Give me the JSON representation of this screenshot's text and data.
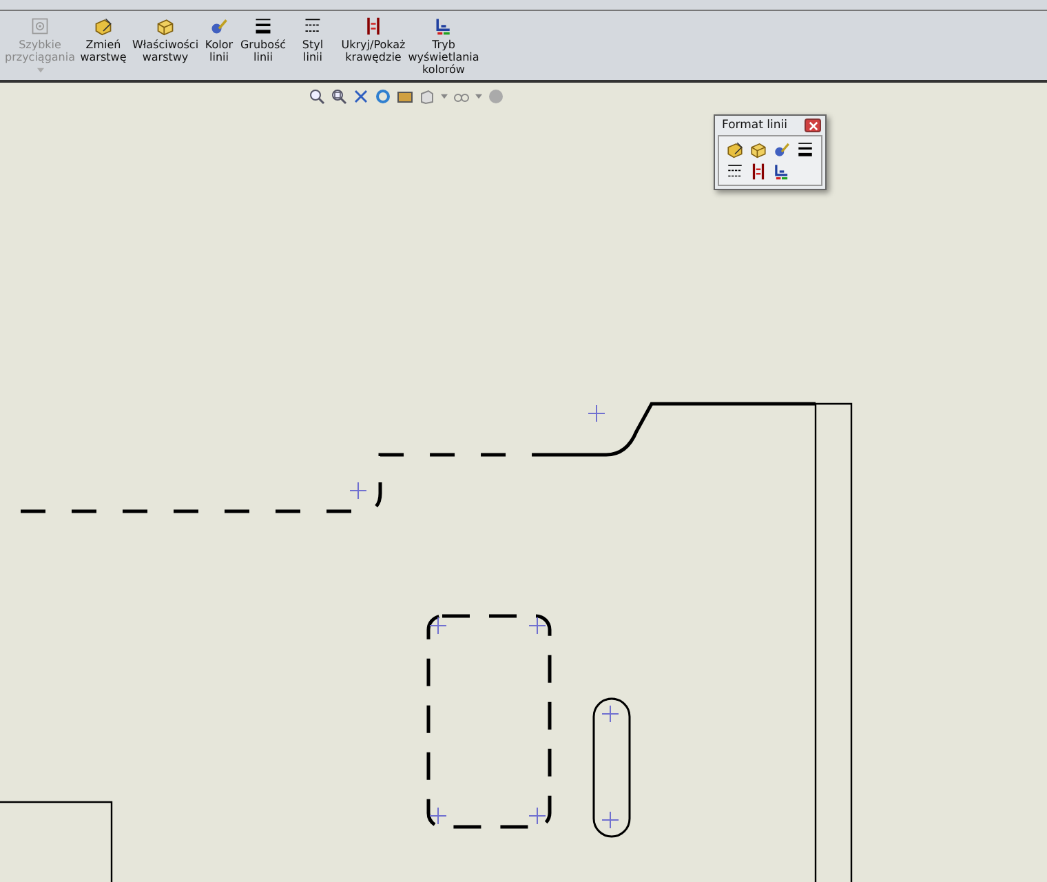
{
  "toolbar": {
    "buttons": [
      {
        "label": "Szybkie przyciągania",
        "disabled": true
      },
      {
        "label": "Zmień warstwę",
        "disabled": false
      },
      {
        "label": "Właściwości warstwy",
        "disabled": false
      },
      {
        "label": "Kolor linii",
        "disabled": false
      },
      {
        "label": "Grubość linii",
        "disabled": false
      },
      {
        "label": "Styl linii",
        "disabled": false
      },
      {
        "label": "Ukryj/Pokaż krawędzie",
        "disabled": false
      },
      {
        "label": "Tryb wyświetlania kolorów",
        "disabled": false
      }
    ]
  },
  "palette": {
    "title": "Format linii"
  }
}
